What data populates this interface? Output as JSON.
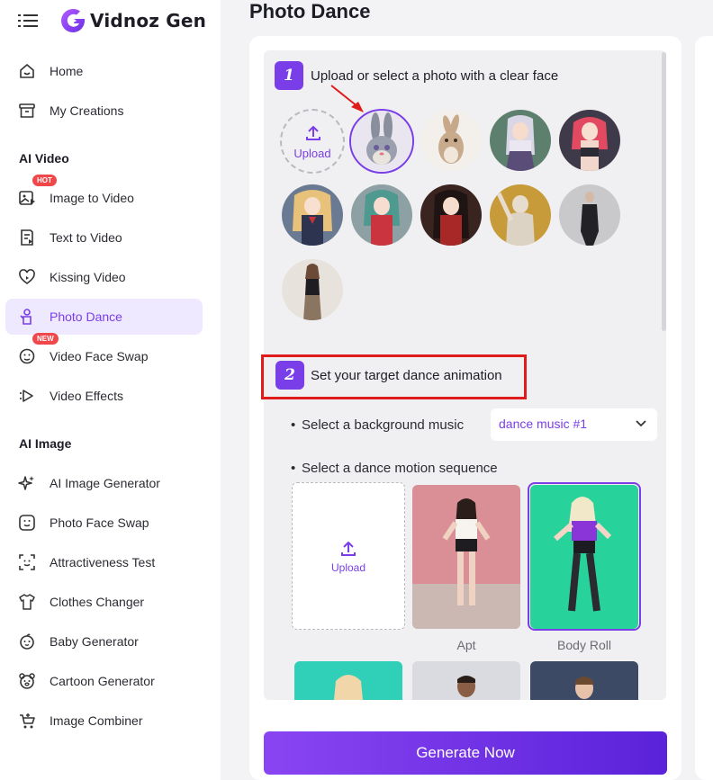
{
  "app": {
    "logo_text": "Vidnoz Gen"
  },
  "sidebar": {
    "top_items": [
      {
        "label": "Home"
      },
      {
        "label": "My Creations"
      }
    ],
    "ai_video_title": "AI Video",
    "ai_video_items": [
      {
        "label": "Image to Video",
        "badge": "HOT"
      },
      {
        "label": "Text to Video"
      },
      {
        "label": "Kissing Video"
      },
      {
        "label": "Photo Dance"
      },
      {
        "label": "Video Face Swap",
        "badge": "NEW"
      },
      {
        "label": "Video Effects"
      }
    ],
    "ai_image_title": "AI Image",
    "ai_image_items": [
      {
        "label": "AI Image Generator"
      },
      {
        "label": "Photo Face Swap"
      },
      {
        "label": "Attractiveness Test"
      },
      {
        "label": "Clothes Changer"
      },
      {
        "label": "Baby Generator"
      },
      {
        "label": "Cartoon Generator"
      },
      {
        "label": "Image Combiner"
      }
    ],
    "active_item": "Photo Dance"
  },
  "main": {
    "page_title": "Photo Dance",
    "step1": {
      "number": "1",
      "title": "Upload or select a photo with a clear face",
      "upload_label": "Upload"
    },
    "step2": {
      "number": "2",
      "title": "Set your target dance animation",
      "music_label": "Select a background music",
      "music_value": "dance music #1",
      "motion_label": "Select a dance motion sequence",
      "upload_label": "Upload",
      "motions": [
        {
          "caption": "Apt"
        },
        {
          "caption": "Body Roll"
        }
      ]
    },
    "generate_label": "Generate Now"
  },
  "colors": {
    "accent": "#7a3ee8",
    "highlight_box": "#e01b1b",
    "badge": "#f0474a"
  }
}
